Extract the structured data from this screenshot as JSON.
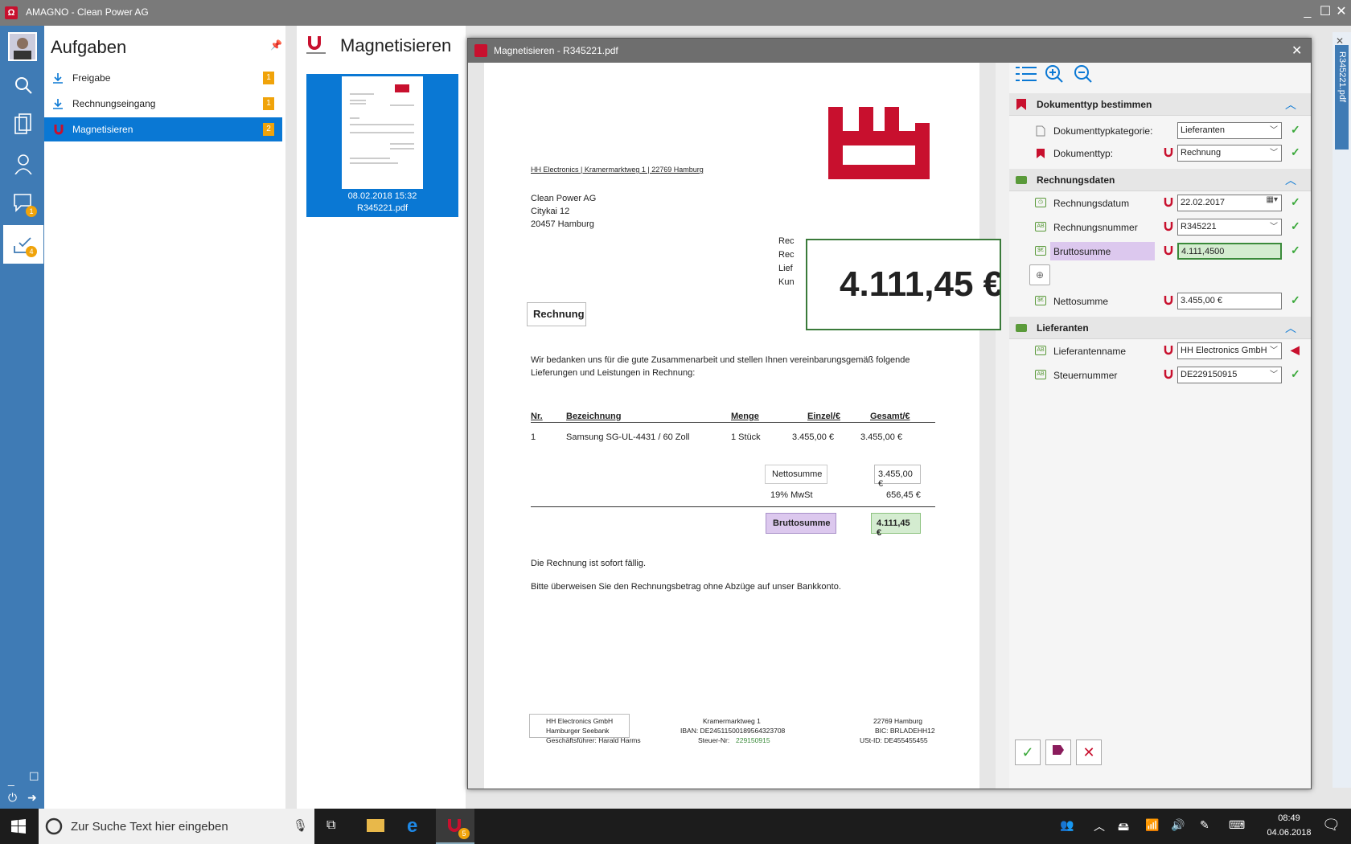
{
  "window": {
    "title": "AMAGNO - Clean Power AG"
  },
  "sidebar": {
    "chat_badge": "1",
    "inbox_badge": "4"
  },
  "tasks": {
    "heading": "Aufgaben",
    "items": [
      {
        "label": "Freigabe",
        "count": "1"
      },
      {
        "label": "Rechnungseingang",
        "count": "1"
      },
      {
        "label": "Magnetisieren",
        "count": "2"
      }
    ]
  },
  "middle": {
    "heading": "Magnetisieren",
    "thumb_date": "08.02.2018 15:32",
    "thumb_file": "R345221.pdf"
  },
  "dialog": {
    "title": "Magnetisieren - R345221.pdf"
  },
  "document": {
    "sender_line": "HH Electronics | Kramermarktweg 1 | 22769 Hamburg",
    "recipient": [
      "Clean Power AG",
      "Citykai 12",
      "20457 Hamburg"
    ],
    "side_labels": [
      "Rec",
      "Rec",
      "Lief",
      "Kun"
    ],
    "zoom_value": "4.111,45 €",
    "heading": "Rechnung",
    "intro": [
      "Wir bedanken uns für die gute Zusammenarbeit und stellen Ihnen vereinbarungsgemäß folgende",
      "Lieferungen und Leistungen in Rechnung:"
    ],
    "table_headers": [
      "Nr.",
      "Bezeichnung",
      "Menge",
      "Einzel/€",
      "Gesamt/€"
    ],
    "row": [
      "1",
      "Samsung SG-UL-4431 / 60 Zoll",
      "1 Stück",
      "3.455,00 €",
      "3.455,00 €"
    ],
    "netto_label": "Nettosumme",
    "netto_value": "3.455,00 €",
    "mwst_label": "19% MwSt",
    "mwst_value": "656,45 €",
    "brutto_label": "Bruttosumme",
    "brutto_value": "4.111,45 €",
    "due": "Die Rechnung ist sofort fällig.",
    "transfer": "Bitte überweisen Sie den Rechnungsbetrag ohne Abzüge auf unser Bankkonto.",
    "footer_left": [
      "HH Electronics GmbH",
      "Hamburger Seebank",
      "Geschäftsführer: Harald Harms"
    ],
    "footer_mid": [
      "Kramermarktweg 1",
      "IBAN: DE24511500189564323708",
      "Steuer-Nr: "
    ],
    "footer_mid_tax": "229150915",
    "footer_right": [
      "22769 Hamburg",
      "BIC: BRLADEHH12",
      "USt-ID: DE455455455"
    ]
  },
  "form": {
    "sections": [
      "Dokumenttyp bestimmen",
      "Rechnungsdaten",
      "Lieferanten"
    ],
    "fields": [
      {
        "label": "Dokumenttypkategorie:",
        "value": "Lieferanten"
      },
      {
        "label": "Dokumenttyp:",
        "value": "Rechnung"
      },
      {
        "label": "Rechnungsdatum",
        "value": "22.02.2017"
      },
      {
        "label": "Rechnungsnummer",
        "value": "R345221"
      },
      {
        "label": "Bruttosumme",
        "value": "4.111,4500"
      },
      {
        "label": "Nettosumme",
        "value": "3.455,00 €"
      },
      {
        "label": "Lieferantenname",
        "value": "HH Electronics GmbH"
      },
      {
        "label": "Steuernummer",
        "value": "DE229150915"
      }
    ],
    "side_tab": "R345221.pdf"
  },
  "taskbar": {
    "search_placeholder": "Zur Suche Text hier eingeben",
    "time": "08:49",
    "date": "04.06.2018",
    "app_badge": "5"
  },
  "colors": {
    "accent": "#0a78d4",
    "rail": "#3f7bb5",
    "brand_red": "#c8102e",
    "badge": "#f0a30a",
    "ok_green": "#3aa83a"
  }
}
